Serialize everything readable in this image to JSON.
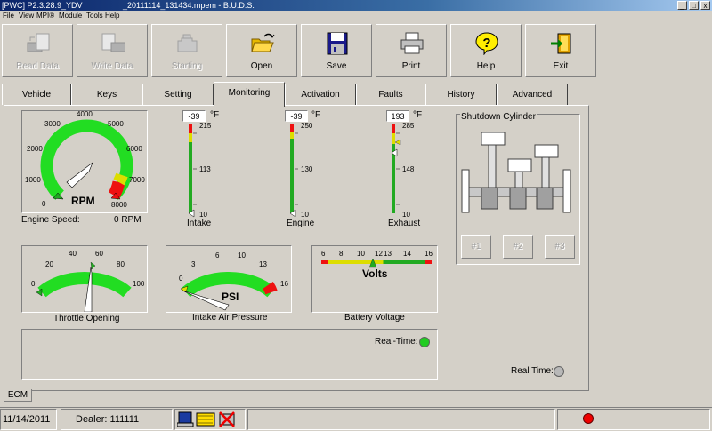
{
  "window": {
    "app_tag": "[PWC] P2.3.28.9_YDV",
    "file": "_20111114_131434.mpem - B.U.D.S.",
    "sys_buttons": [
      "_",
      "□",
      "x"
    ]
  },
  "menu": [
    "File",
    "View",
    "MPI®",
    "Module",
    "Tools",
    "Help"
  ],
  "toolbar": [
    {
      "label": "Read Data",
      "icon": "read-data-icon",
      "enabled": false
    },
    {
      "label": "Write Data",
      "icon": "write-data-icon",
      "enabled": false
    },
    {
      "label": "Starting",
      "icon": "engine-icon",
      "enabled": false
    },
    {
      "label": "Open",
      "icon": "folder-open-icon",
      "enabled": true
    },
    {
      "label": "Save",
      "icon": "floppy-disk-icon",
      "enabled": true
    },
    {
      "label": "Print",
      "icon": "printer-icon",
      "enabled": true
    },
    {
      "label": "Help",
      "icon": "help-question-icon",
      "enabled": true
    },
    {
      "label": "Exit",
      "icon": "exit-door-icon",
      "enabled": true
    }
  ],
  "tabs": [
    "Vehicle",
    "Keys",
    "Setting",
    "Monitoring",
    "Activation",
    "Faults",
    "History",
    "Advanced"
  ],
  "active_tab": "Monitoring",
  "rpm_gauge": {
    "ticks": [
      "0",
      "1000",
      "2000",
      "3000",
      "4000",
      "5000",
      "6000",
      "7000",
      "8000"
    ],
    "unit": "RPM",
    "label": "Engine Speed:",
    "value_text": "0 RPM",
    "value": 0
  },
  "temps": [
    {
      "label": "Intake",
      "value": "-39",
      "unit": "°F",
      "max": "215",
      "mid": "113",
      "min": "10"
    },
    {
      "label": "Engine",
      "value": "-39",
      "unit": "°F",
      "max": "250",
      "mid": "130",
      "min": "10"
    },
    {
      "label": "Exhaust",
      "value": "193",
      "unit": "°F",
      "max": "285",
      "mid": "148",
      "min": "10"
    }
  ],
  "shutdown": {
    "title": "Shutdown Cylinder",
    "buttons": [
      "#1",
      "#2",
      "#3"
    ]
  },
  "throttle": {
    "ticks": [
      "0",
      "20",
      "40",
      "60",
      "80",
      "100"
    ],
    "label": "Throttle Opening"
  },
  "pressure": {
    "ticks": [
      "0",
      "3",
      "6",
      "10",
      "13",
      "16"
    ],
    "unit": "PSI",
    "label": "Intake Air Pressure"
  },
  "battery": {
    "ticks": [
      "6",
      "8",
      "10",
      "12",
      "13",
      "14",
      "16"
    ],
    "unit": "Volts",
    "label": "Battery Voltage"
  },
  "realtime1": {
    "label": "Real-Time:",
    "color": "#22cc22"
  },
  "realtime2": {
    "label": "Real Time:",
    "color": "#b8b8b8"
  },
  "ecm_tab": "ECM",
  "status": {
    "date": "11/14/2011",
    "dealer": "Dealer: 111111",
    "indicator_color": "#ee0000"
  },
  "colors": {
    "gauge_green": "#22dd22",
    "gauge_yellow": "#dddd00",
    "gauge_red": "#ee1111"
  }
}
